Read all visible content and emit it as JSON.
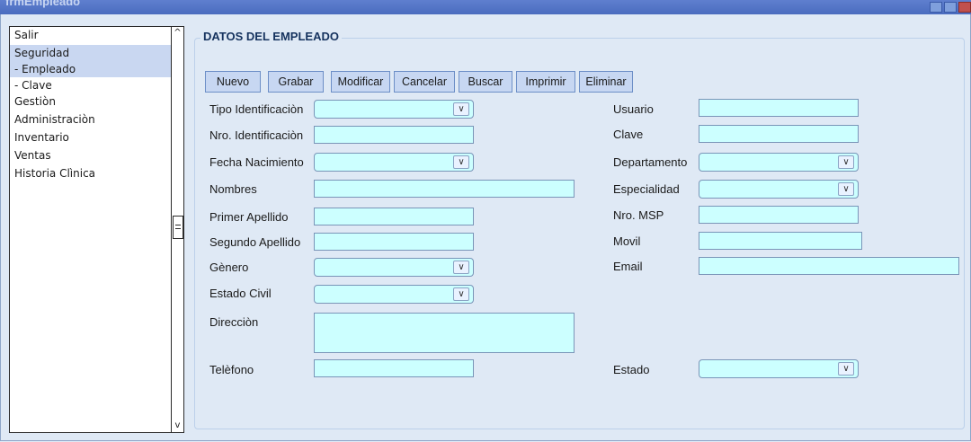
{
  "window": {
    "title": "frmEmpleado"
  },
  "sidebar": {
    "items": [
      {
        "label": "Salir",
        "selected": false
      },
      {
        "label": "Seguridad",
        "selected": true
      },
      {
        "label": "- Empleado",
        "selected": true
      },
      {
        "label": "- Clave",
        "selected": false
      },
      {
        "label": "Gestiòn",
        "selected": false
      },
      {
        "label": "Administraciòn",
        "selected": false
      },
      {
        "label": "Inventario",
        "selected": false
      },
      {
        "label": "Ventas",
        "selected": false
      },
      {
        "label": "Historia Clìnica",
        "selected": false
      }
    ],
    "scroll_up": "^",
    "scroll_down": "v"
  },
  "form": {
    "title": "DATOS DEL EMPLEADO",
    "buttons": [
      "Nuevo",
      "Grabar",
      "Modificar",
      "Cancelar",
      "Buscar",
      "Imprimir",
      "Eliminar"
    ],
    "fields": {
      "tipo_identificacion": {
        "label": "Tipo Identificaciòn",
        "value": ""
      },
      "nro_identificacion": {
        "label": "Nro. Identificaciòn",
        "value": ""
      },
      "fecha_nacimiento": {
        "label": "Fecha Nacimiento",
        "value": ""
      },
      "nombres": {
        "label": "Nombres",
        "value": ""
      },
      "primer_apellido": {
        "label": "Primer Apellido",
        "value": ""
      },
      "segundo_apellido": {
        "label": "Segundo Apellido",
        "value": ""
      },
      "genero": {
        "label": "Gènero",
        "value": ""
      },
      "estado_civil": {
        "label": "Estado Civil",
        "value": ""
      },
      "direccion": {
        "label": "Direcciòn",
        "value": ""
      },
      "telefono": {
        "label": "Telèfono",
        "value": ""
      },
      "usuario": {
        "label": "Usuario",
        "value": ""
      },
      "clave": {
        "label": "Clave",
        "value": ""
      },
      "departamento": {
        "label": "Departamento",
        "value": ""
      },
      "especialidad": {
        "label": "Especialidad",
        "value": ""
      },
      "nro_msp": {
        "label": "Nro. MSP",
        "value": ""
      },
      "movil": {
        "label": "Movil",
        "value": ""
      },
      "email": {
        "label": "Email",
        "value": ""
      },
      "estado": {
        "label": "Estado",
        "value": ""
      }
    },
    "dropdown_arrow": "∨"
  },
  "colors": {
    "input_bg": "#ccffff",
    "button_bg": "#c7d7f2",
    "window_bg": "#dfe9f5",
    "selected_item": "#c9d7f1"
  }
}
